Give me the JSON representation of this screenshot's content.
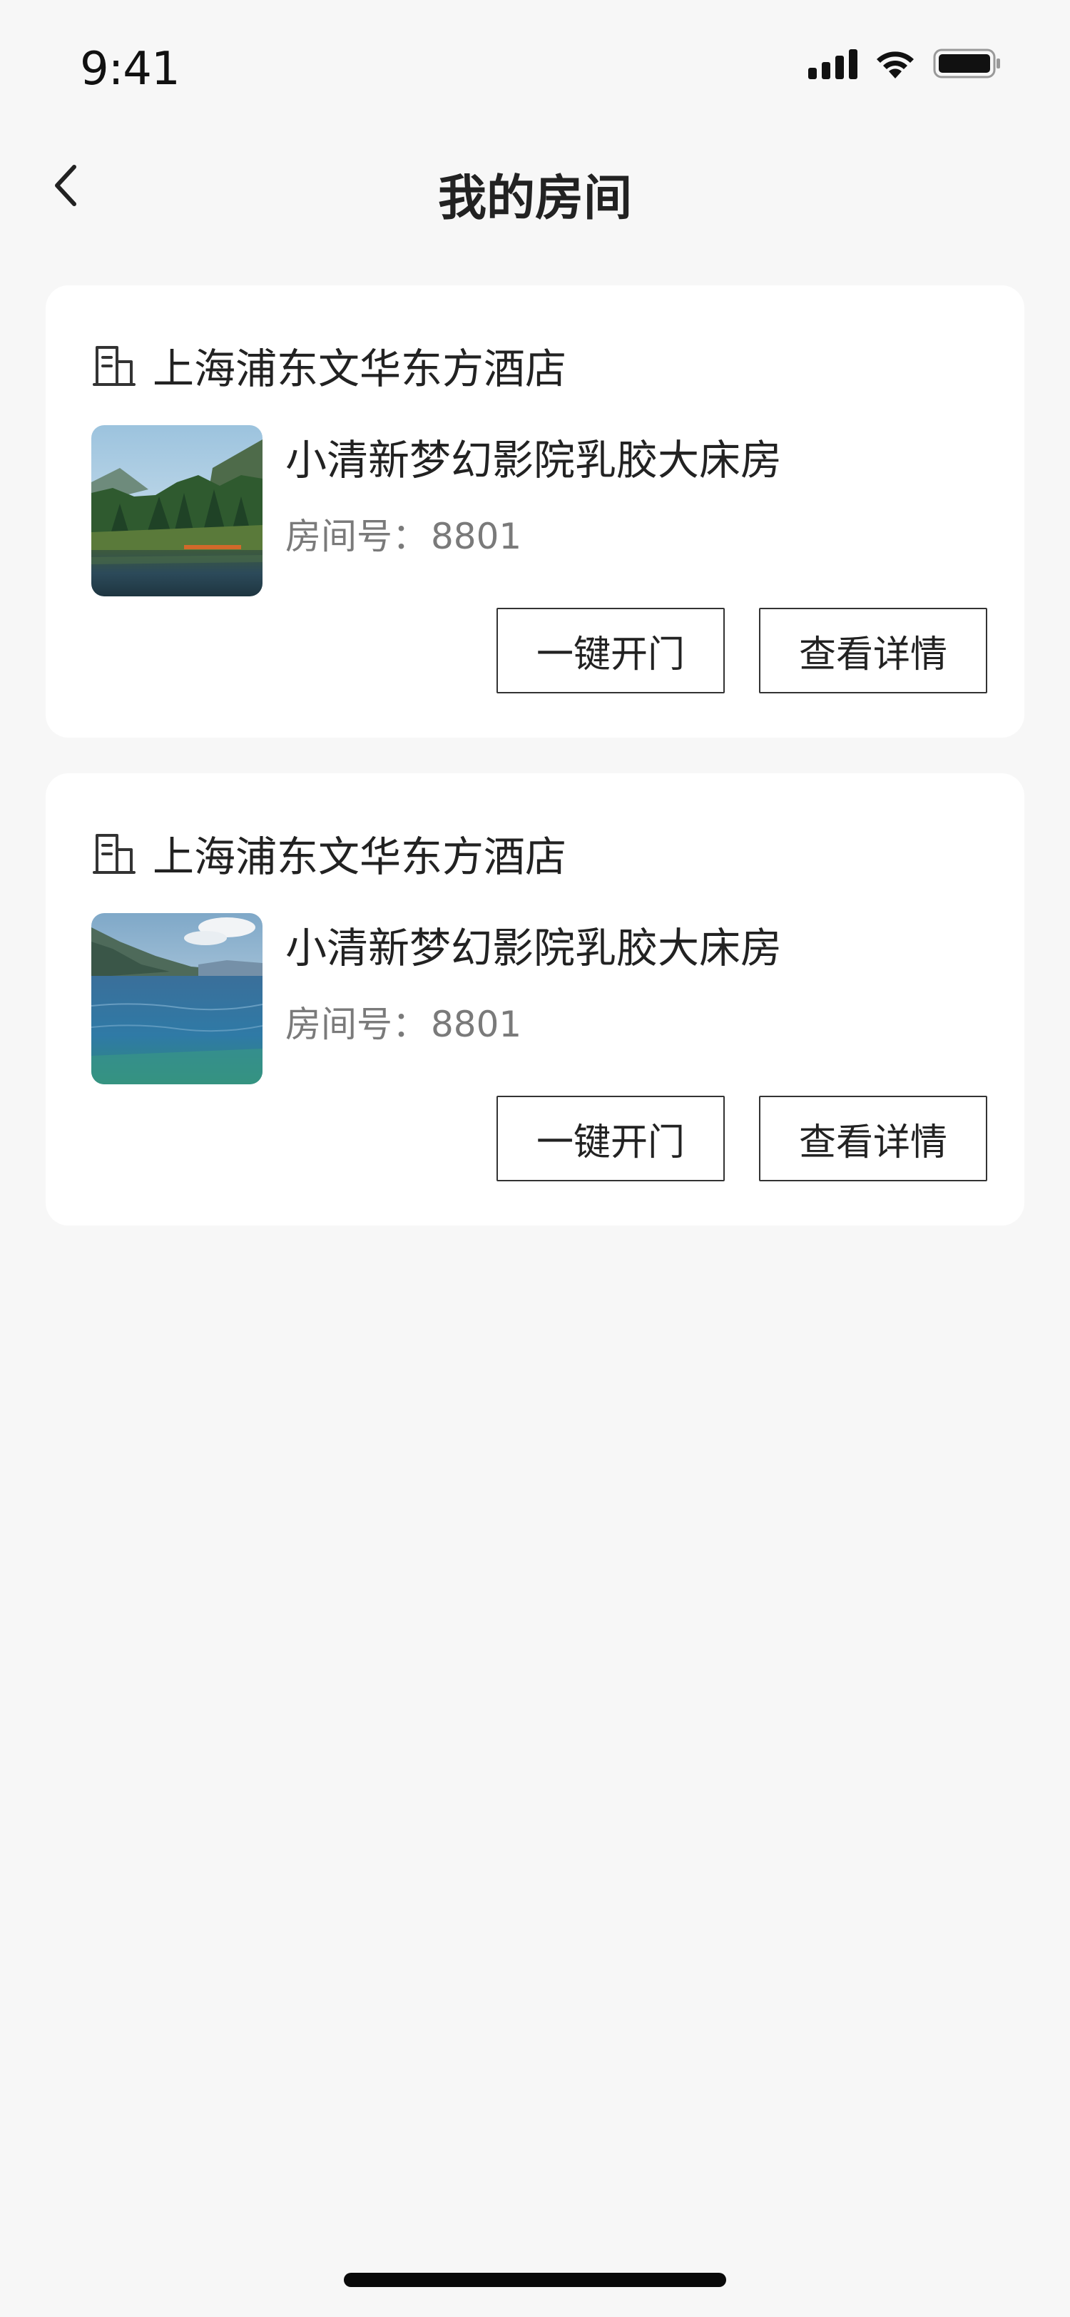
{
  "status_bar": {
    "time": "9:41"
  },
  "nav": {
    "title": "我的房间"
  },
  "rooms": [
    {
      "hotel": "上海浦东文华东方酒店",
      "room_name": "小清新梦幻影院乳胶大床房",
      "room_number_label": "房间号：",
      "room_number": "8801",
      "open_label": "一键开门",
      "detail_label": "查看详情",
      "thumbnail": "forest-lake-photo"
    },
    {
      "hotel": "上海浦东文华东方酒店",
      "room_name": "小清新梦幻影院乳胶大床房",
      "room_number_label": "房间号：",
      "room_number": "8801",
      "open_label": "一键开门",
      "detail_label": "查看详情",
      "thumbnail": "mountain-lake-photo"
    }
  ],
  "icons": {
    "back": "chevron-left-icon",
    "hotel": "building-icon",
    "signal": "cellular-signal-icon",
    "wifi": "wifi-icon",
    "battery": "battery-icon"
  },
  "colors": {
    "background": "#f7f7f7",
    "card": "#ffffff",
    "text_primary": "#222222",
    "text_secondary": "#7a7a7a",
    "button_border": "#333333"
  }
}
